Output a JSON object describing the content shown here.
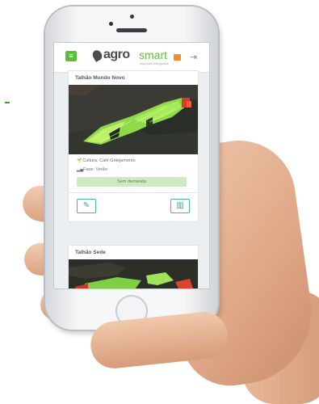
{
  "app": {
    "logo_part1": "agro",
    "logo_part2": "smart",
    "logo_tagline": "soluções integradas",
    "icons": {
      "menu": "hamburger-menu-icon",
      "logout": "logout-icon",
      "edit": "edit-icon",
      "chart": "bar-chart-icon",
      "culture": "plant-icon",
      "phase": "signal-icon"
    }
  },
  "fields": [
    {
      "title": "Talhão Mundo Novo",
      "culture": "Cultura: Café Gotejamento",
      "phase": "Fase: Verão",
      "demand": "Sem demanda"
    },
    {
      "title": "Talhão Sede"
    }
  ],
  "colors": {
    "accent_green": "#5cbf3a",
    "demand_bg": "#cfe9c4",
    "button_teal": "#4bb2a3"
  }
}
